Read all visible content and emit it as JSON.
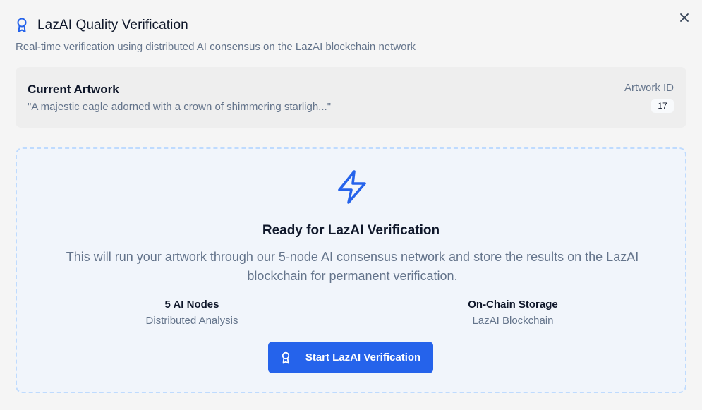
{
  "dialog": {
    "title": "LazAI Quality Verification",
    "subtitle": "Real-time verification using distributed AI consensus on the LazAI blockchain network",
    "title_icon": "award-icon",
    "close_icon": "close-icon"
  },
  "artwork": {
    "label": "Current Artwork",
    "prompt": "\"A majestic eagle adorned with a crown of shimmering starligh...\"",
    "id_label": "Artwork ID",
    "id_value": "17"
  },
  "ready": {
    "icon": "lightning-bolt-icon",
    "title": "Ready for LazAI Verification",
    "description": "This will run your artwork through our 5-node AI consensus network and store the results on the LazAI blockchain for permanent verification.",
    "features": [
      {
        "title": "5 AI Nodes",
        "subtitle": "Distributed Analysis"
      },
      {
        "title": "On-Chain Storage",
        "subtitle": "LazAI Blockchain"
      }
    ],
    "button_label": "Start LazAI Verification",
    "button_icon": "award-icon"
  },
  "colors": {
    "accent": "#2563eb",
    "panel_border": "#bfdbfe",
    "muted_text": "#64748b",
    "heading_text": "#0f172a"
  }
}
